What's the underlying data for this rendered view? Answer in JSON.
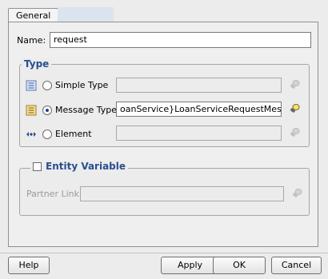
{
  "tabs": [
    {
      "label": "General"
    }
  ],
  "name": {
    "label": "Name:",
    "value": "request"
  },
  "type_group": {
    "legend": "Type",
    "options": [
      {
        "label": "Simple Type",
        "selected": false,
        "value": ""
      },
      {
        "label": "Message Type",
        "selected": true,
        "value": "oanService}LoanServiceRequestMessage"
      },
      {
        "label": "Element",
        "selected": false,
        "value": ""
      }
    ]
  },
  "entity_group": {
    "legend": "Entity Variable",
    "checked": false,
    "partner_link_label": "Partner Link:",
    "partner_link_value": ""
  },
  "buttons": {
    "help": "Help",
    "apply": "Apply",
    "ok": "OK",
    "cancel": "Cancel"
  },
  "icons": {
    "simple_type": "simple-type-icon",
    "message_type": "message-type-icon",
    "element": "element-icon",
    "browse": "flashlight-icon"
  }
}
